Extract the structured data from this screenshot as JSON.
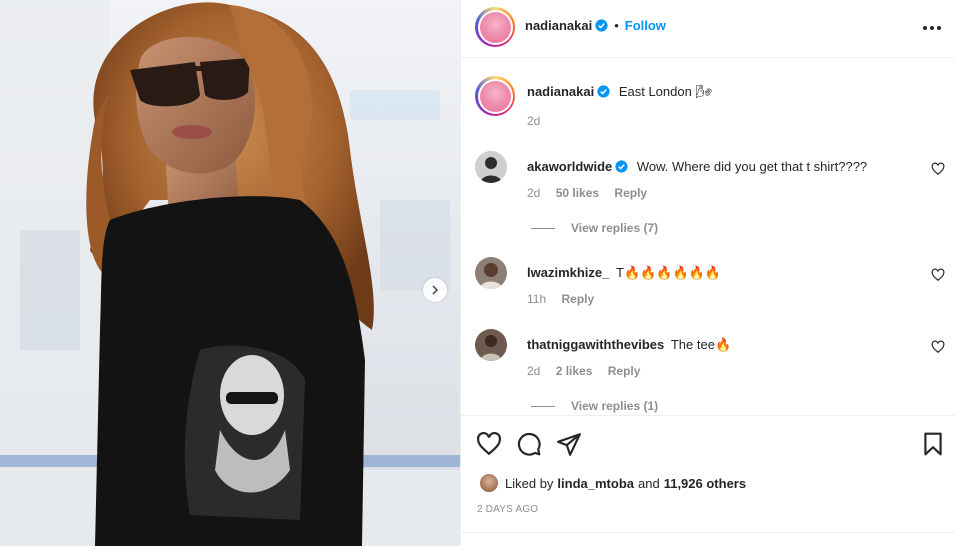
{
  "post": {
    "author": "nadianakai",
    "follow_label": "Follow",
    "dot": "•",
    "caption": "East London 🌬",
    "caption_age": "2d",
    "liked_by_prefix": "Liked by",
    "liked_by_user": "linda_mtoba",
    "liked_by_and": "and",
    "liked_by_others": "11,926 others",
    "date": "2 DAYS AGO"
  },
  "comments": [
    {
      "user": "akaworldwide",
      "verified": true,
      "text": "Wow. Where did you get that t shirt????",
      "age": "2d",
      "likes": "50 likes",
      "reply_label": "Reply",
      "view_replies": "View replies (7)"
    },
    {
      "user": "lwazimkhize_",
      "verified": false,
      "text": "T🔥🔥🔥🔥🔥🔥",
      "age": "11h",
      "likes": "",
      "reply_label": "Reply",
      "view_replies": ""
    },
    {
      "user": "thatniggawiththevibes",
      "verified": false,
      "text": "The tee🔥",
      "age": "2d",
      "likes": "2 likes",
      "reply_label": "Reply",
      "view_replies": "View replies (1)"
    }
  ],
  "icons": {
    "verified": "verified-badge-icon",
    "more": "more-options-icon",
    "like": "heart-icon",
    "comment": "comment-icon",
    "share": "share-icon",
    "save": "bookmark-icon",
    "next": "chevron-right-icon"
  },
  "colors": {
    "accent": "#0095f6",
    "text": "#262626",
    "muted": "#8e8e8e",
    "border": "#efefef"
  }
}
